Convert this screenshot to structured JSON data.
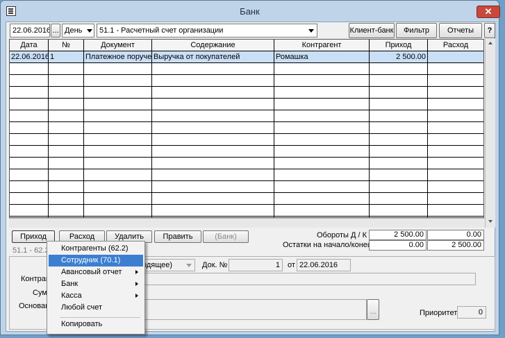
{
  "window": {
    "title": "Банк"
  },
  "toolbar": {
    "date": "22.06.2016",
    "dots": "...",
    "period": "День",
    "account": "51.1 - Расчетный счет организации",
    "client_bank": "Клиент-банк",
    "filter": "Фильтр",
    "reports": "Отчеты",
    "help": "?"
  },
  "table": {
    "columns": [
      "Дата",
      "№",
      "Документ",
      "Содержание",
      "Контрагент",
      "Приход",
      "Расход"
    ],
    "rows": [
      [
        "22.06.2016",
        "1",
        "Платежное поручение",
        "Выручка от покупателей",
        "Ромашка",
        "2 500.00",
        ""
      ]
    ]
  },
  "actions": {
    "income": "Приход",
    "expense": "Расход",
    "delete": "Удалить",
    "edit": "Править",
    "bank": "(Банк)"
  },
  "totals": {
    "turnover_label": "Обороты Д / К",
    "turnover_debit": "2 500.00",
    "turnover_credit": "0.00",
    "balance_label": "Остатки на начало/конец",
    "balance_start": "0.00",
    "balance_end": "2 500.00"
  },
  "detail": {
    "account_code": "51.1 - 62.2",
    "direction": "одящее)",
    "doc_no_label": "Док. №",
    "doc_no": "1",
    "from_label": "от",
    "doc_date": "22.06.2016",
    "counterparty_label": "Контраг",
    "sum_label": "Сум",
    "basis_label": "Основан",
    "dots": "...",
    "priority_label": "Приоритет",
    "priority": "0"
  },
  "context_menu": {
    "items": [
      {
        "label": "Контрагенты (62.2)",
        "submenu": false
      },
      {
        "label": "Сотрудник (70.1)",
        "submenu": false,
        "highlighted": true
      },
      {
        "label": "Авансовый отчет",
        "submenu": true
      },
      {
        "label": "Банк",
        "submenu": true
      },
      {
        "label": "Касса",
        "submenu": true
      },
      {
        "label": "Любой счет",
        "submenu": false
      }
    ],
    "copy": "Копировать"
  },
  "colors": {
    "selection": "#c9dff5",
    "menu_highlight": "#3c7fd1",
    "close": "#c9483c"
  }
}
